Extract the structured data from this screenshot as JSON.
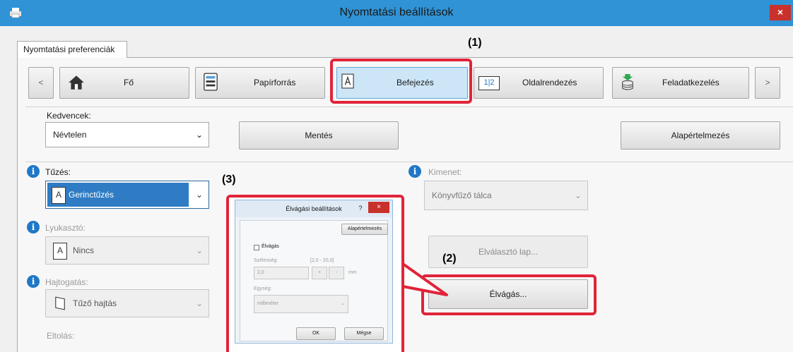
{
  "window": {
    "title": "Nyomtatási beállítások",
    "close": "×"
  },
  "tab": {
    "label": "Nyomtatási preferenciák"
  },
  "nav": {
    "prev": "<",
    "next": ">",
    "items": [
      {
        "label": "Fő"
      },
      {
        "label": "Papírforrás"
      },
      {
        "label": "Befejezés"
      },
      {
        "label": "Oldalrendezés",
        "icon_text": "1|2"
      },
      {
        "label": "Feladatkezelés"
      }
    ]
  },
  "favorites": {
    "label": "Kedvencek:",
    "value": "Névtelen",
    "save": "Mentés",
    "defaults": "Alapértelmezés"
  },
  "stapling": {
    "label": "Tűzés:",
    "value": "Gerinctűzés"
  },
  "punch": {
    "label": "Lyukasztó:",
    "value": "Nincs"
  },
  "fold": {
    "label": "Hajtogatás:",
    "value": "Tűző hajtás"
  },
  "offset": {
    "label": "Eltolás:"
  },
  "output": {
    "label": "Kimenet:",
    "value": "Könyvfűző tálca"
  },
  "separator_page": {
    "label": "Elválasztó lap..."
  },
  "trim_button": {
    "label": "Élvágás..."
  },
  "callouts": {
    "c1": "(1)",
    "c2": "(2)",
    "c3": "(3)"
  },
  "trim_dialog": {
    "title": "Élvágási beállítások",
    "help": "?",
    "close": "×",
    "defaults": "Alapértelmezés",
    "checkbox": "Élvágás",
    "width_label": "Szélesség:",
    "range": "[2,0 - 20,0]",
    "width_value": "2,0",
    "plus": "+",
    "minus": "-",
    "unit_suffix": "mm",
    "unit_label": "Egység:",
    "unit_value": "milliméter",
    "ok": "OK",
    "cancel": "Mégse"
  },
  "colors": {
    "accent": "#2f93d6",
    "callout": "#e0243a",
    "selected": "#2f7cc4"
  }
}
